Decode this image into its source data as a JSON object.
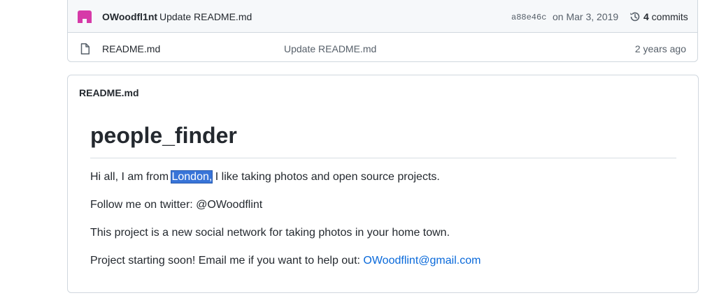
{
  "commit_bar": {
    "author": "OWoodfl1nt",
    "message": "Update README.md",
    "sha": "a88e46c",
    "date": "on Mar 3, 2019",
    "commits_count": "4",
    "commits_label": " commits",
    "history_icon": "history-icon",
    "avatar_color": "#d63aa8"
  },
  "files": [
    {
      "icon": "file-icon",
      "name": "README.md",
      "last_commit": "Update README.md",
      "age": "2 years ago"
    }
  ],
  "readme": {
    "header": "README.md",
    "title": "people_finder",
    "intro_before": "Hi all, I am from ",
    "intro_highlight": "London,",
    "intro_after": " I like taking photos and open source projects.",
    "twitter_line": "Follow me on twitter: @OWoodflint",
    "project_line": "This project is a new social network for taking photos in your home town.",
    "email_before": "Project starting soon! Email me if you want to help out: ",
    "email_link": "OWoodflint@gmail.com"
  },
  "colors": {
    "link": "#0969da",
    "selection": "#3874d8",
    "border": "#d0d7de"
  }
}
